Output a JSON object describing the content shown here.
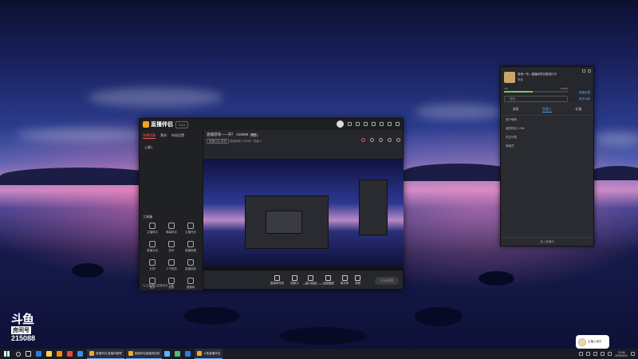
{
  "wallpaper": {
    "description_colors": [
      "#1a2260",
      "#c28bc8",
      "#0d1035"
    ]
  },
  "watermark": {
    "logo": "斗鱼",
    "label": "房间号",
    "room_number": "215088"
  },
  "app": {
    "name": "直播伴侣",
    "version_badge": "V3.0",
    "left_tabs": [
      "场景列表",
      "素材",
      "布局设置"
    ],
    "scene": "上屏1",
    "tools_title": "工具箱",
    "tools": [
      "主播助手",
      "弹幕助手",
      "主播任务",
      "直播互动",
      "挂件",
      "直播数据",
      "礼物",
      "人气相关",
      "直播回放",
      "更多",
      "连麦",
      "直播间"
    ],
    "footer": "为主播提供直播常用工具",
    "room_title": "直播游戏——开！",
    "room_id": "215088",
    "room_tag": "精选",
    "room_category": "直播分区-单机",
    "room_meta": "语音房间  215088  ·  热度 0",
    "bottom_tools": [
      "直播间导航",
      "摄像头",
      "窗口投屏",
      "全屏截图",
      "素材库",
      "美颜"
    ],
    "start_button": "开始直播",
    "status": "CPU 7%  内存 12%  00:00:00"
  },
  "viewer": {
    "title": "绝地一号—直播间排位赛进行中",
    "subtitle": "等级",
    "progress_left": "LV5",
    "progress_right": "4718分",
    "progress": 0.45,
    "link1": "直播设置",
    "link2": "更多功能",
    "search_placeholder": "搜索",
    "tabs": [
      "消息",
      "观看人",
      "礼物"
    ],
    "active_tab": 1,
    "items": [
      "用户昵称",
      "我的粉丝  1.15k",
      "关注列表",
      "房管员"
    ],
    "footer": "进入直播间"
  },
  "taskbar": {
    "tasks": [
      "直播伴侣-直播间管理",
      "直播伴侣直播间控制",
      "斗鱼直播伴侣"
    ],
    "clock_time": "13:46",
    "clock_date": "2020/4/21",
    "icon_colors": [
      "#2d7be5",
      "#ffd24a",
      "#ff8a00",
      "#e34b3c",
      "#3b8de5",
      "#5ab0ff",
      "#49c07a",
      "#2d7be5"
    ]
  },
  "sticker": {
    "text": "主播上线中"
  }
}
